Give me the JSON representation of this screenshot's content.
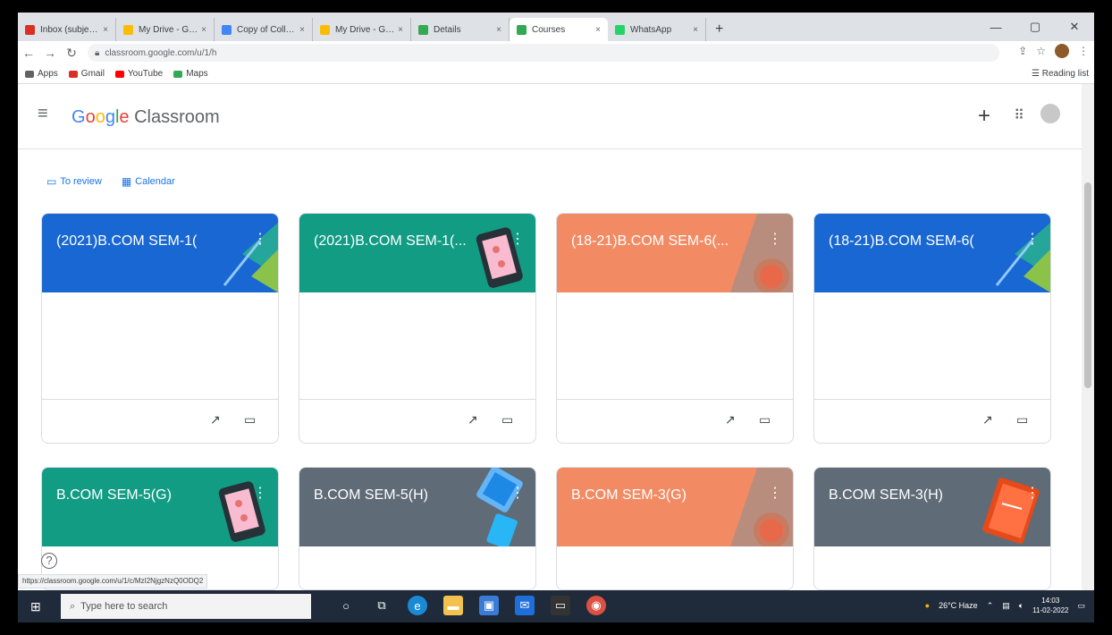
{
  "browser": {
    "tabs": [
      {
        "label": "Inbox (subject) - Inc",
        "fav_color": "#d93025",
        "active": false
      },
      {
        "label": "My Drive - Google Drive",
        "fav_color": "#fbbc05",
        "active": false
      },
      {
        "label": "Copy of College",
        "fav_color": "#4285f4",
        "active": false
      },
      {
        "label": "My Drive - Google Drive",
        "fav_color": "#fbbc05",
        "active": false
      },
      {
        "label": "Details",
        "fav_color": "#34a853",
        "active": false
      },
      {
        "label": "Courses",
        "fav_color": "#34a853",
        "active": true
      },
      {
        "label": "WhatsApp",
        "fav_color": "#25d366",
        "active": false
      }
    ],
    "tab_close": "×",
    "new_tab": "+",
    "window_controls": [
      "—",
      "▢",
      "✕"
    ],
    "url": "classroom.google.com/u/1/h",
    "bookmarks": [
      {
        "label": "Apps",
        "color": "#5f6368"
      },
      {
        "label": "Gmail",
        "color": "#d93025"
      },
      {
        "label": "YouTube",
        "color": "#ff0000"
      },
      {
        "label": "Maps",
        "color": "#34a853"
      }
    ],
    "reading_list": "Reading list"
  },
  "app": {
    "logo_google": [
      "G",
      "o",
      "o",
      "g",
      "l",
      "e"
    ],
    "logo_product": "Classroom",
    "menu_icon": "≡",
    "add_icon": "+",
    "apps_icon": "⋮⋮⋮",
    "to_review": "To review",
    "calendar": "Calendar"
  },
  "cards": [
    {
      "title": "(2021)B.COM SEM-1(",
      "color": "#1967d2",
      "deco": "teal"
    },
    {
      "title": "(2021)B.COM SEM-1(...",
      "color": "#129c84",
      "deco": "phone"
    },
    {
      "title": "(18-21)B.COM SEM-6(...",
      "color": "#f28b64",
      "deco": "circle"
    },
    {
      "title": "(18-21)B.COM SEM-6(",
      "color": "#1967d2",
      "deco": "teal"
    },
    {
      "title": "B.COM SEM-5(G)",
      "color": "#129c84",
      "deco": "phone"
    },
    {
      "title": "B.COM SEM-5(H)",
      "color": "#5f6b76",
      "deco": "book"
    },
    {
      "title": "B.COM SEM-3(G)",
      "color": "#f28b64",
      "deco": "circle"
    },
    {
      "title": "B.COM SEM-3(H)",
      "color": "#5f6b76",
      "deco": "notebook"
    }
  ],
  "status_url": "https://classroom.google.com/u/1/c/MzI2NjgzNzQ0ODQ2",
  "taskbar": {
    "search_placeholder": "Type here to search",
    "weather": "26°C Haze",
    "time": "14:03",
    "date": "11-02-2022"
  }
}
